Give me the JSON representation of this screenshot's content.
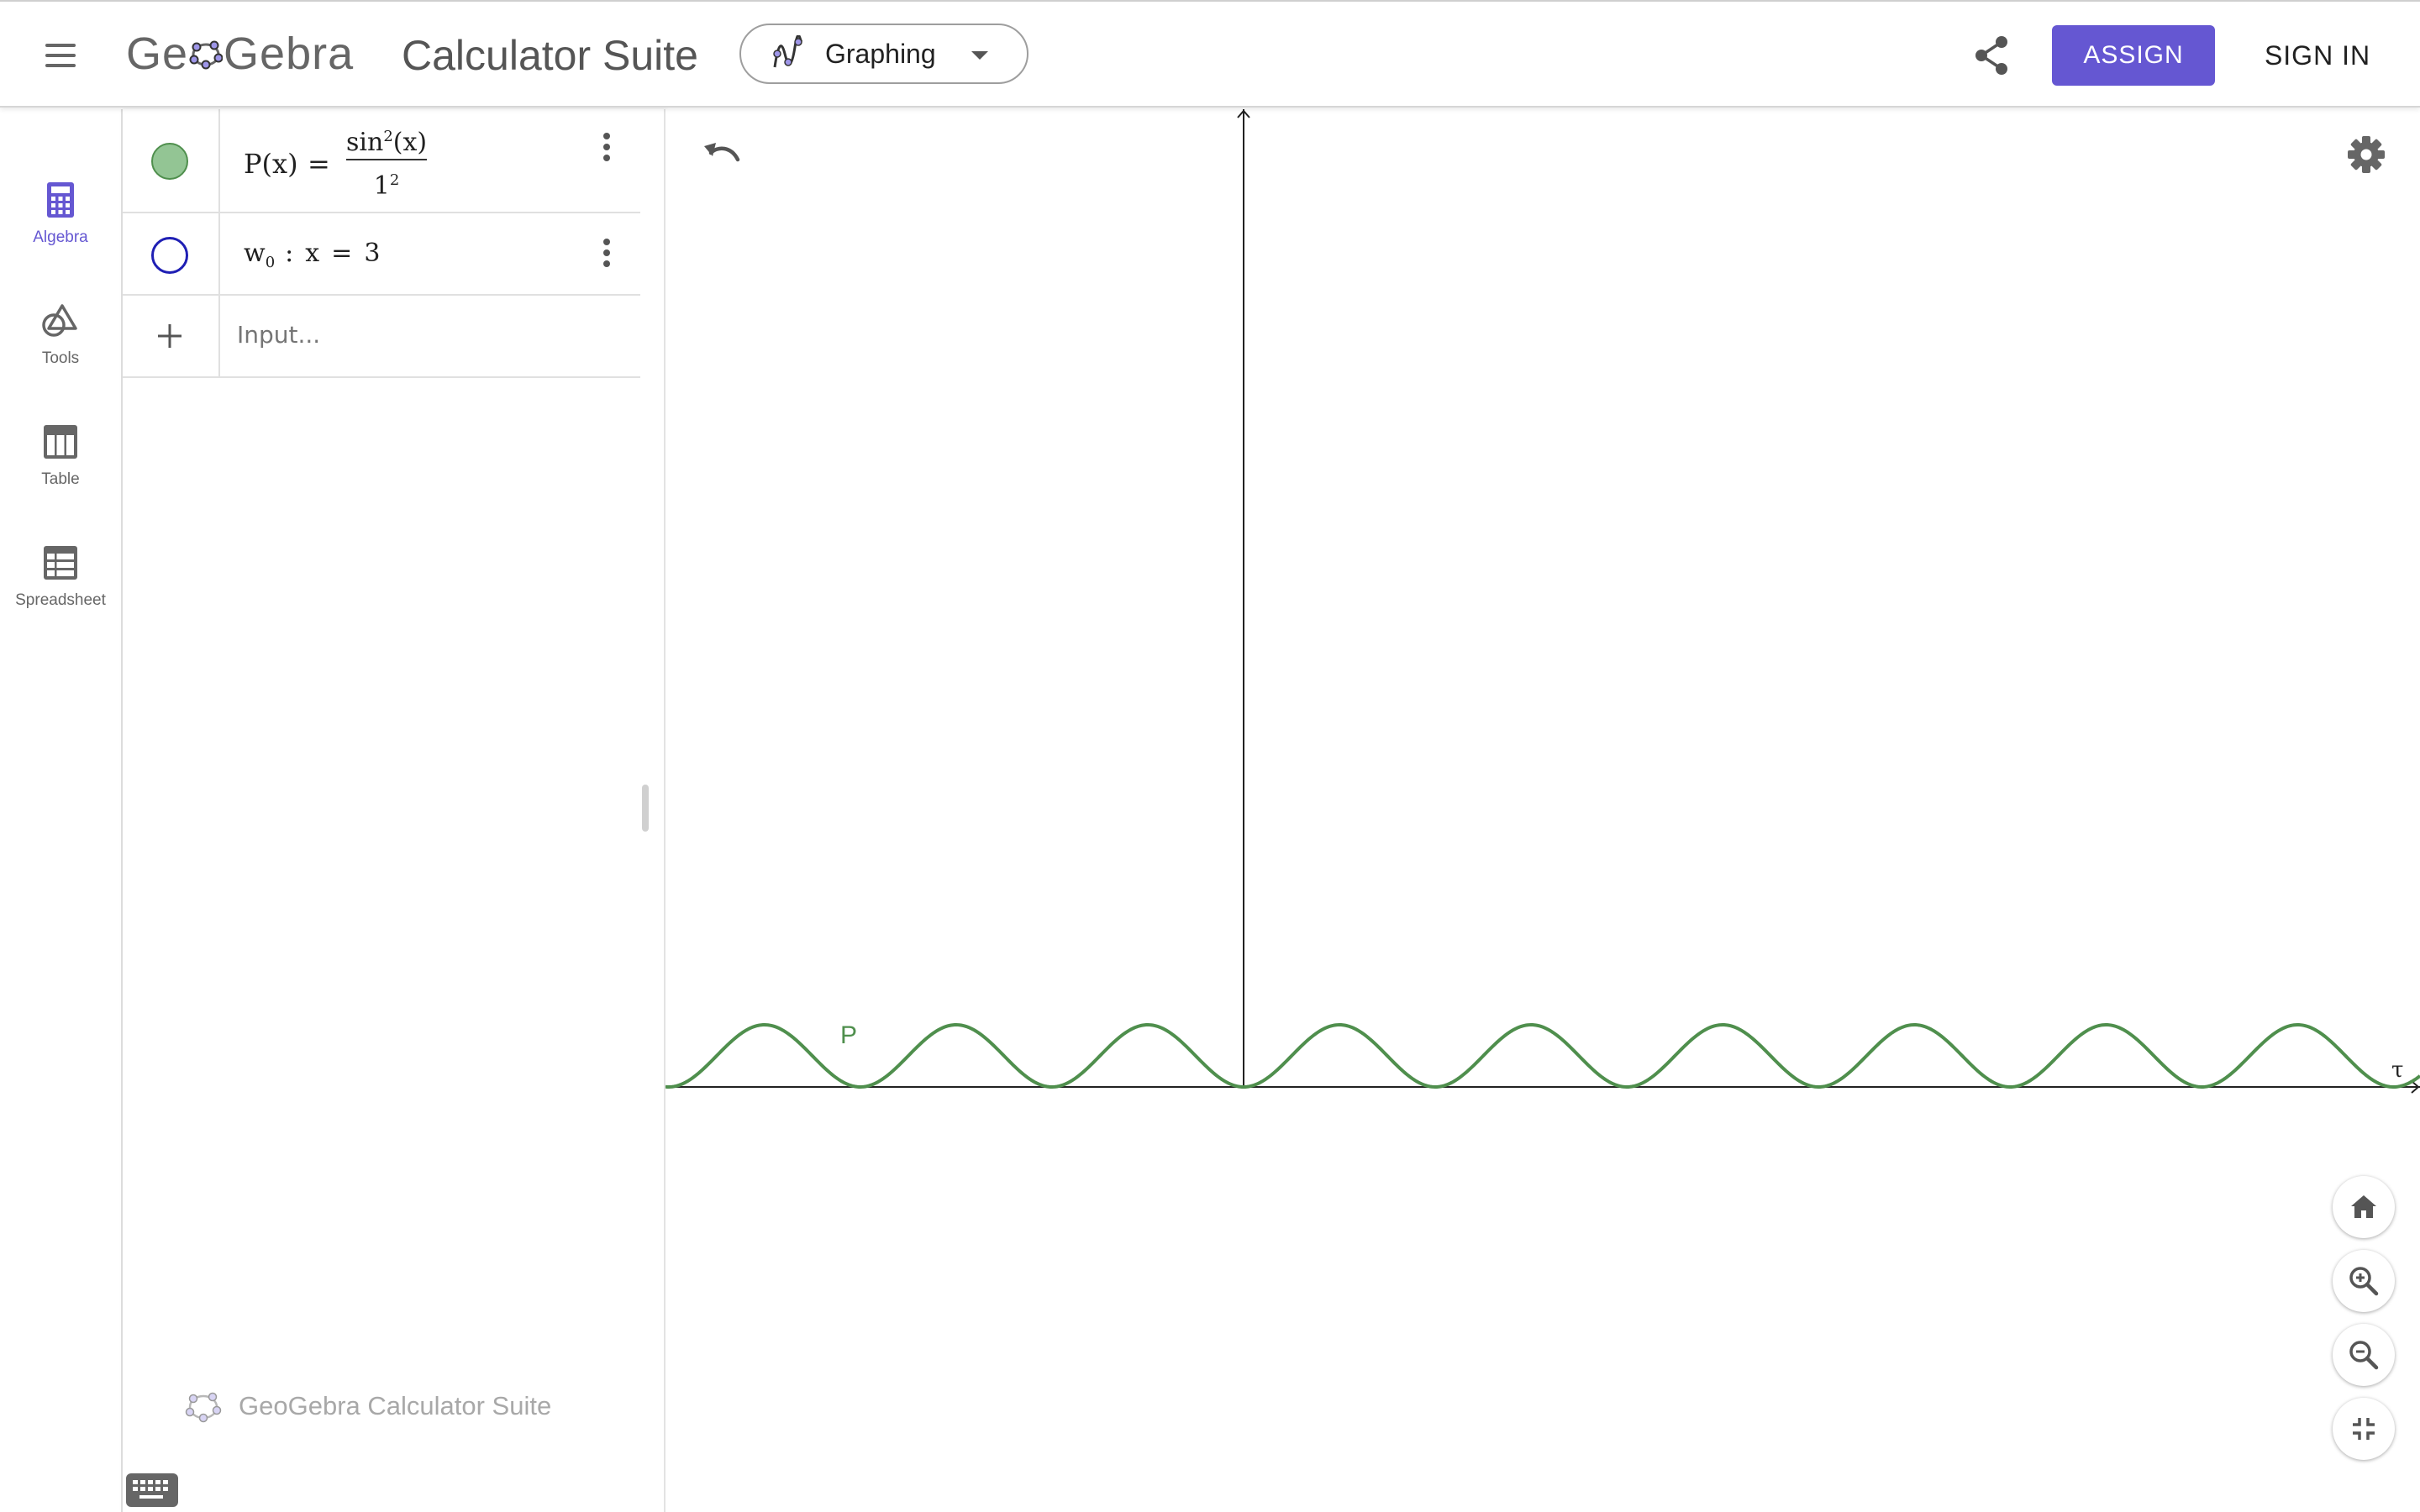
{
  "header": {
    "menu_icon": "hamburger-menu-icon",
    "logo_text_before": "Ge",
    "logo_text_after": "Gebra",
    "title": "Calculator Suite",
    "app_picker": {
      "label": "Graphing",
      "icon": "graphing-icon"
    },
    "share_icon": "share-icon",
    "assign_label": "ASSIGN",
    "signin_label": "SIGN IN",
    "accent_color": "#6557d2"
  },
  "sidebar": {
    "items": [
      {
        "label": "Algebra",
        "icon": "calculator-icon",
        "active": true
      },
      {
        "label": "Tools",
        "icon": "tools-shapes-icon",
        "active": false
      },
      {
        "label": "Table",
        "icon": "table-icon",
        "active": false
      },
      {
        "label": "Spreadsheet",
        "icon": "spreadsheet-icon",
        "active": false
      }
    ]
  },
  "algebra": {
    "rows": [
      {
        "lhs": "P(x)",
        "eq": "=",
        "numerator": "sin",
        "numerator_exp": "2",
        "numerator_arg": "(x)",
        "denominator": "1",
        "denominator_exp": "2",
        "marble_color": "#93c594",
        "visible": true
      },
      {
        "name": "w",
        "subscript": "0",
        "colon": ":",
        "lhs": "x",
        "eq": "=",
        "rhs": "3",
        "marble_color": "#1f1fb4",
        "visible": false
      }
    ],
    "input_placeholder": "Input...",
    "add_icon": "plus-icon",
    "more_icon": "more-vertical-icon",
    "watermark": "GeoGebra Calculator Suite",
    "keyboard_icon": "keyboard-icon"
  },
  "graphics": {
    "undo_icon": "undo-icon",
    "settings_icon": "settings-gear-icon",
    "curve_label": "P",
    "x_axis_label": "τ",
    "curve_color": "#4f8f4d",
    "buttons": [
      {
        "icon": "home-icon"
      },
      {
        "icon": "zoom-in-icon"
      },
      {
        "icon": "zoom-out-icon"
      },
      {
        "icon": "exit-fullscreen-icon"
      }
    ]
  }
}
